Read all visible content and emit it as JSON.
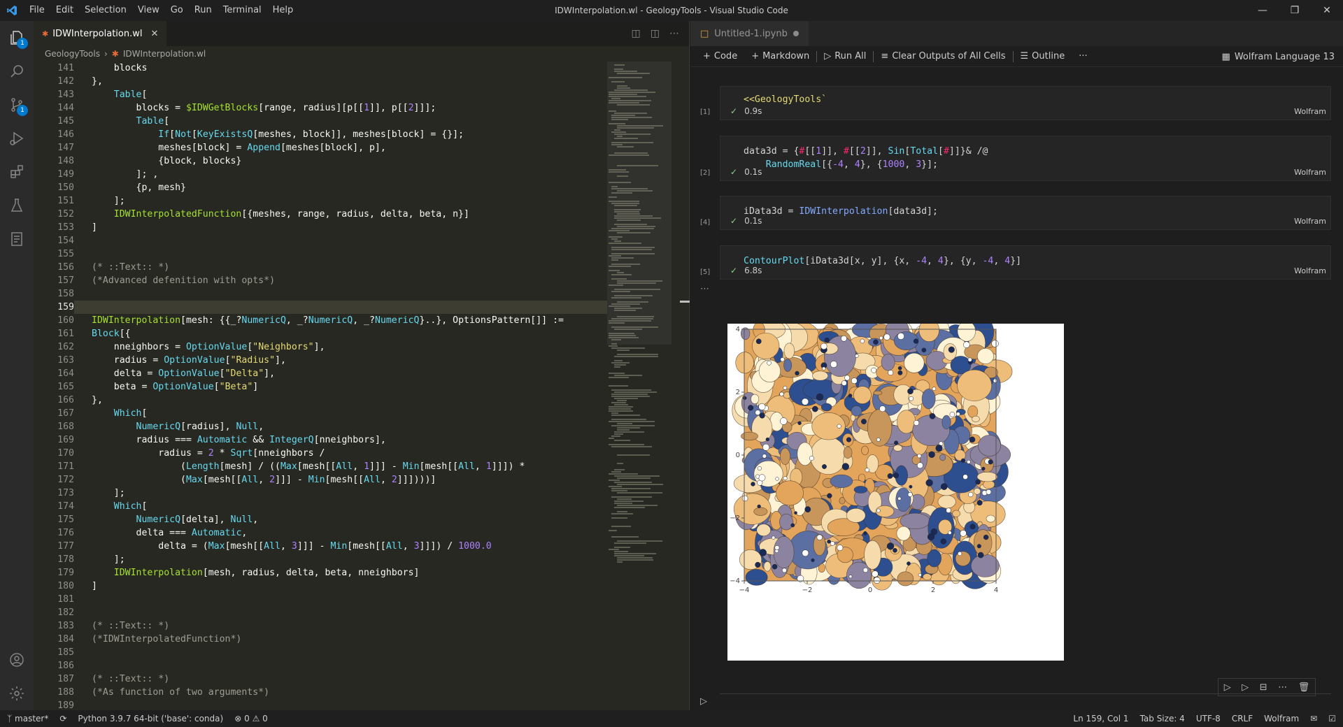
{
  "titlebar": {
    "menu": [
      "File",
      "Edit",
      "Selection",
      "View",
      "Go",
      "Run",
      "Terminal",
      "Help"
    ],
    "title": "IDWInterpolation.wl - GeologyTools - Visual Studio Code"
  },
  "activity": {
    "badges": {
      "explorer": "1",
      "scm": "1"
    }
  },
  "editor": {
    "tab_label": "IDWInterpolation.wl",
    "breadcrumb": [
      "GeologyTools",
      "IDWInterpolation.wl"
    ],
    "current_line": 159,
    "lines": [
      {
        "n": 141,
        "t": "    blocks"
      },
      {
        "n": 142,
        "t": "},"
      },
      {
        "n": 143,
        "t": "    Table["
      },
      {
        "n": 144,
        "t": "        blocks = $IDWGetBlocks[range, radius][p[[1]], p[[2]]];"
      },
      {
        "n": 145,
        "t": "        Table["
      },
      {
        "n": 146,
        "t": "            If[Not[KeyExistsQ[meshes, block]], meshes[block] = {}];"
      },
      {
        "n": 147,
        "t": "            meshes[block] = Append[meshes[block], p],"
      },
      {
        "n": 148,
        "t": "            {block, blocks}"
      },
      {
        "n": 149,
        "t": "        ]; ,"
      },
      {
        "n": 150,
        "t": "        {p, mesh}"
      },
      {
        "n": 151,
        "t": "    ];"
      },
      {
        "n": 152,
        "t": "    IDWInterpolatedFunction[{meshes, range, radius, delta, beta, n}]"
      },
      {
        "n": 153,
        "t": "]"
      },
      {
        "n": 154,
        "t": ""
      },
      {
        "n": 155,
        "t": ""
      },
      {
        "n": 156,
        "t": "(* ::Text:: *)"
      },
      {
        "n": 157,
        "t": "(*Advanced defenition with opts*)"
      },
      {
        "n": 158,
        "t": ""
      },
      {
        "n": 159,
        "t": ""
      },
      {
        "n": 160,
        "t": "IDWInterpolation[mesh: {{_?NumericQ, _?NumericQ, _?NumericQ}..}, OptionsPattern[]] :="
      },
      {
        "n": 161,
        "t": "Block[{"
      },
      {
        "n": 162,
        "t": "    nneighbors = OptionValue[\"Neighbors\"],"
      },
      {
        "n": 163,
        "t": "    radius = OptionValue[\"Radius\"],"
      },
      {
        "n": 164,
        "t": "    delta = OptionValue[\"Delta\"],"
      },
      {
        "n": 165,
        "t": "    beta = OptionValue[\"Beta\"]"
      },
      {
        "n": 166,
        "t": "},"
      },
      {
        "n": 167,
        "t": "    Which["
      },
      {
        "n": 168,
        "t": "        NumericQ[radius], Null,"
      },
      {
        "n": 169,
        "t": "        radius === Automatic && IntegerQ[nneighbors],"
      },
      {
        "n": 170,
        "t": "            radius = 2 * Sqrt[nneighbors /"
      },
      {
        "n": 171,
        "t": "                (Length[mesh] / ((Max[mesh[[All, 1]]] - Min[mesh[[All, 1]]]) *"
      },
      {
        "n": 172,
        "t": "                (Max[mesh[[All, 2]]] - Min[mesh[[All, 2]]])))]"
      },
      {
        "n": 173,
        "t": "    ];"
      },
      {
        "n": 174,
        "t": "    Which["
      },
      {
        "n": 175,
        "t": "        NumericQ[delta], Null,"
      },
      {
        "n": 176,
        "t": "        delta === Automatic,"
      },
      {
        "n": 177,
        "t": "            delta = (Max[mesh[[All, 3]]] - Min[mesh[[All, 3]]]) / 1000.0"
      },
      {
        "n": 178,
        "t": "    ];"
      },
      {
        "n": 179,
        "t": "    IDWInterpolation[mesh, radius, delta, beta, nneighbors]"
      },
      {
        "n": 180,
        "t": "]"
      },
      {
        "n": 181,
        "t": ""
      },
      {
        "n": 182,
        "t": ""
      },
      {
        "n": 183,
        "t": "(* ::Text:: *)"
      },
      {
        "n": 184,
        "t": "(*IDWInterpolatedFunction*)"
      },
      {
        "n": 185,
        "t": ""
      },
      {
        "n": 186,
        "t": ""
      },
      {
        "n": 187,
        "t": "(* ::Text:: *)"
      },
      {
        "n": 188,
        "t": "(*As function of two arguments*)"
      },
      {
        "n": 189,
        "t": ""
      }
    ]
  },
  "notebook": {
    "tab_label": "Untitled-1.ipynb",
    "toolbar": {
      "code": "Code",
      "markdown": "Markdown",
      "run_all": "Run All",
      "clear": "Clear Outputs of All Cells",
      "outline": "Outline",
      "more": "···"
    },
    "kernel": "Wolfram Language 13",
    "cells": [
      {
        "exec": "[1]",
        "code": "<<GeologyTools`",
        "time": "0.9s",
        "lang": "Wolfram"
      },
      {
        "exec": "[2]",
        "code": "data3d = {#[[1]], #[[2]], Sin[Total[#]]}& /@\n    RandomReal[{-4, 4}, {1000, 3}];",
        "time": "0.1s",
        "lang": "Wolfram"
      },
      {
        "exec": "[4]",
        "code": "iData3d = IDWInterpolation[data3d];",
        "time": "0.1s",
        "lang": "Wolfram"
      },
      {
        "exec": "[5]",
        "code": "ContourPlot[iData3d[x, y], {x, -4, 4}, {y, -4, 4}]",
        "time": "6.8s",
        "lang": "Wolfram"
      }
    ]
  },
  "chart_data": {
    "type": "heatmap",
    "title": "",
    "xlabel": "",
    "ylabel": "",
    "xlim": [
      -4,
      4
    ],
    "ylim": [
      -4,
      4
    ],
    "x_ticks": [
      "−4",
      "−2",
      "0",
      "2",
      "4"
    ],
    "y_ticks": [
      "4",
      "2",
      "0",
      "−2",
      "−4"
    ],
    "colors": [
      "#2e4f8f",
      "#5b6fa3",
      "#8b83a0",
      "#c8955a",
      "#e3a45c",
      "#eebd7a",
      "#f6dcac",
      "#fff3d6"
    ]
  },
  "statusbar": {
    "branch": "master*",
    "python": "Python 3.9.7 64-bit ('base': conda)",
    "problems": "0",
    "warnings": "0",
    "position": "Ln 159, Col 1",
    "tab_size": "Tab Size: 4",
    "encoding": "UTF-8",
    "eol": "CRLF",
    "language": "Wolfram"
  }
}
